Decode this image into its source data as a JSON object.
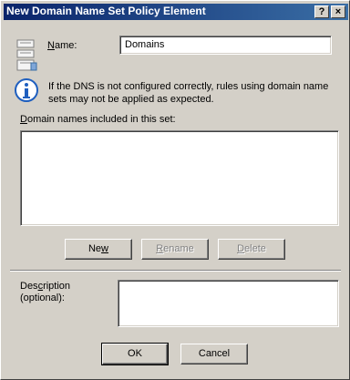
{
  "window": {
    "title": "New Domain Name Set Policy Element",
    "help_glyph": "?",
    "close_glyph": "×"
  },
  "name_field": {
    "label_prefix": "",
    "label_mnemonic": "N",
    "label_suffix": "ame:",
    "value": "Domains"
  },
  "info": {
    "text": "If the DNS is not configured correctly, rules using domain name sets may not be applied as expected."
  },
  "domains": {
    "label_mnemonic": "D",
    "label_suffix": "omain names included in this set:",
    "items": []
  },
  "list_buttons": {
    "new": {
      "before": "Ne",
      "mnemonic": "w",
      "after": ""
    },
    "rename": {
      "before": "",
      "mnemonic": "R",
      "after": "ename"
    },
    "delete": {
      "before": "",
      "mnemonic": "D",
      "after": "elete"
    }
  },
  "description": {
    "line1_before": "Des",
    "line1_mnemonic": "c",
    "line1_after": "ription",
    "line2": "(optional):",
    "value": ""
  },
  "footer": {
    "ok_label": "OK",
    "cancel_label": "Cancel"
  },
  "colors": {
    "face": "#d4d0c8",
    "title_start": "#0a246a",
    "title_end": "#3a6ea5",
    "info_icon": "#1f5fbf"
  }
}
